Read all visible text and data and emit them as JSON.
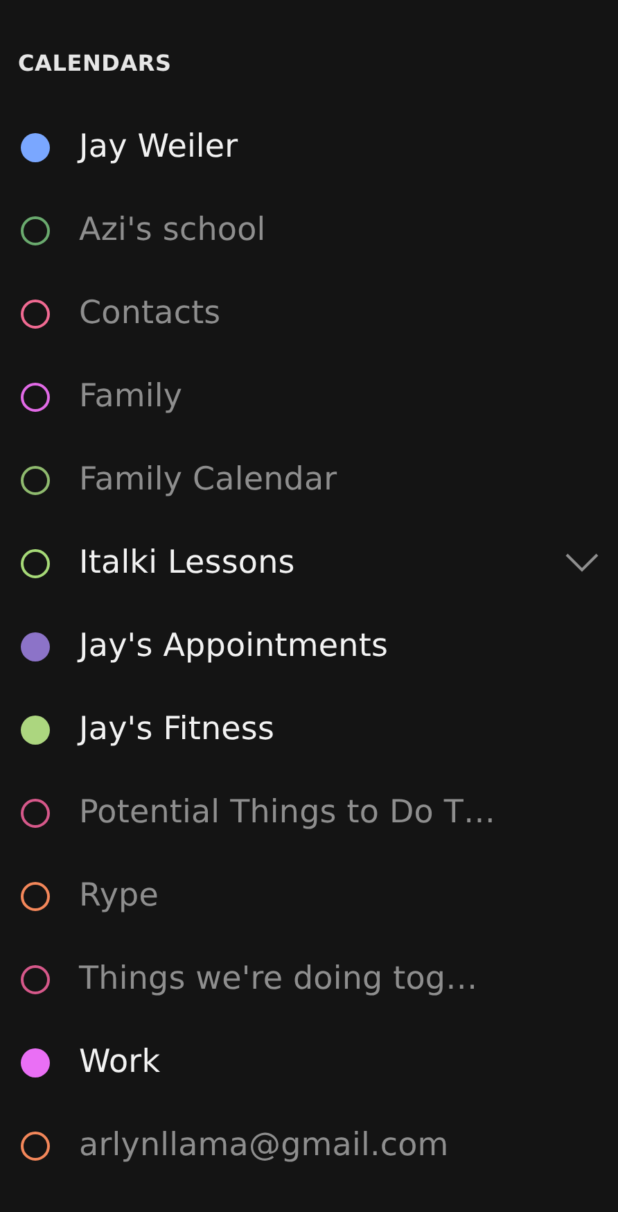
{
  "heading": "CALENDARS",
  "calendars": [
    {
      "name": "Jay Weiler",
      "color": "#7aa7ff",
      "checked": true,
      "hovered": false
    },
    {
      "name": "Azi's school",
      "color": "#6aaa6e",
      "checked": false,
      "hovered": false
    },
    {
      "name": "Contacts",
      "color": "#f06a92",
      "checked": false,
      "hovered": false
    },
    {
      "name": "Family",
      "color": "#e16ae6",
      "checked": false,
      "hovered": false
    },
    {
      "name": "Family Calendar",
      "color": "#8fba6e",
      "checked": false,
      "hovered": false
    },
    {
      "name": "Italki Lessons",
      "color": "#a6d977",
      "checked": false,
      "hovered": true
    },
    {
      "name": "Jay's Appointments",
      "color": "#8c73c8",
      "checked": true,
      "hovered": false
    },
    {
      "name": "Jay's Fitness",
      "color": "#acd67f",
      "checked": true,
      "hovered": false
    },
    {
      "name": "Potential Things to Do T…",
      "color": "#d6588a",
      "checked": false,
      "hovered": false
    },
    {
      "name": "Rype",
      "color": "#f3875a",
      "checked": false,
      "hovered": false
    },
    {
      "name": "Things we're doing tog…",
      "color": "#d6588a",
      "checked": false,
      "hovered": false
    },
    {
      "name": "Work",
      "color": "#ea6ff5",
      "checked": true,
      "hovered": false
    },
    {
      "name": "arlynllama@gmail.com",
      "color": "#f3875a",
      "checked": false,
      "hovered": false
    }
  ]
}
